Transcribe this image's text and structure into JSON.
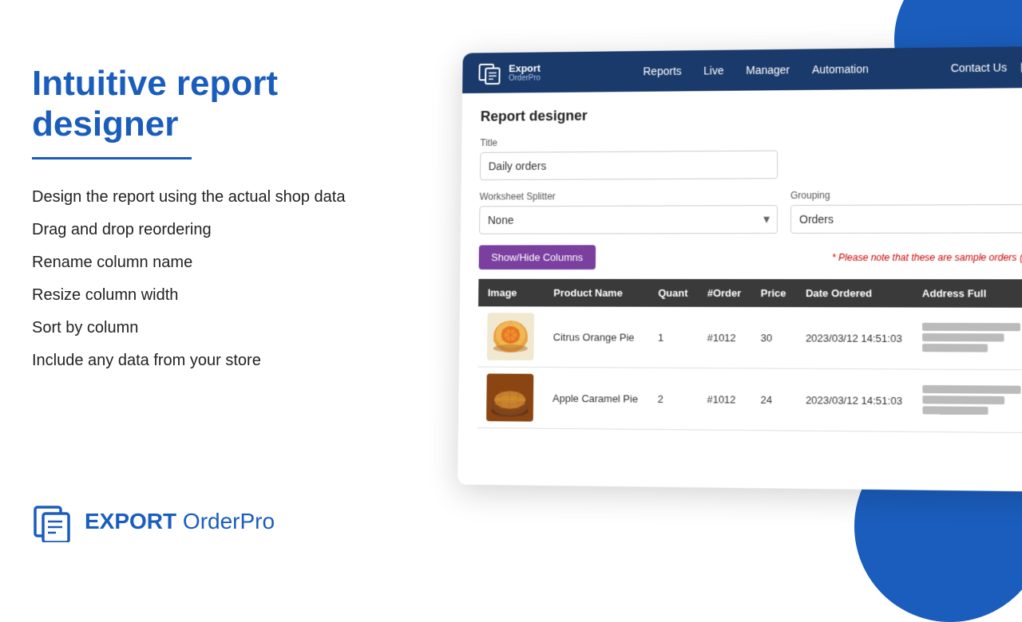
{
  "background": {
    "color": "#ffffff"
  },
  "left": {
    "heading": "Intuitive report designer",
    "underline_color": "#1a5dbd",
    "features": [
      "Design the report using the actual shop data",
      "Drag and drop reordering",
      "Rename column name",
      "Resize column width",
      "Sort by column",
      "Include any data from your store"
    ],
    "logo": {
      "export_text": "EXPORT",
      "orderpro_text": " OrderPro"
    }
  },
  "nav": {
    "logo_name": "Export",
    "logo_sub": "OrderPro",
    "links": [
      "Reports",
      "Live",
      "Manager",
      "Automation"
    ],
    "contact": "Contact Us"
  },
  "report_designer": {
    "title": "Report designer",
    "form": {
      "title_label": "Title",
      "title_value": "Daily orders",
      "worksheet_label": "Worksheet Splitter",
      "worksheet_value": "None",
      "grouping_label": "Grouping",
      "grouping_value": "Orders"
    },
    "show_hide_button": "Show/Hide Columns",
    "sample_note": "* Please note that these are sample orders (la",
    "table": {
      "columns": [
        "Image",
        "Product Name",
        "Quant",
        "#Order",
        "Price",
        "Date Ordered",
        "Address Full"
      ],
      "rows": [
        {
          "product_name": "Citrus Orange Pie",
          "quantity": "1",
          "order_num": "#1012",
          "price": "30",
          "date_ordered": "2023/03/12 14:51:03",
          "has_image": true,
          "image_type": "orange_pie"
        },
        {
          "product_name": "Apple Caramel Pie",
          "quantity": "2",
          "order_num": "#1012",
          "price": "24",
          "date_ordered": "2023/03/12 14:51:03",
          "has_image": true,
          "image_type": "apple_pie"
        }
      ]
    }
  }
}
